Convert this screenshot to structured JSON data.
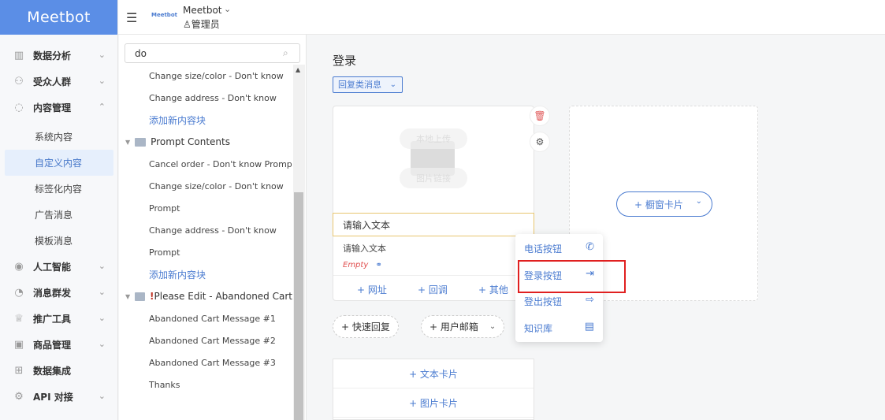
{
  "app": {
    "brand": "Meetbot"
  },
  "nav": {
    "items": [
      {
        "label": "数据分析",
        "icon": "chart-icon",
        "chevron": "⌄"
      },
      {
        "label": "受众人群",
        "icon": "users-icon",
        "chevron": "⌄"
      },
      {
        "label": "内容管理",
        "icon": "chat-icon",
        "chevron": "⌃"
      }
    ],
    "subitems": [
      "系统内容",
      "自定义内容",
      "标签化内容",
      "广告消息",
      "模板消息"
    ],
    "items2": [
      {
        "label": "人工智能",
        "icon": "ai-icon",
        "chevron": "⌄"
      },
      {
        "label": "消息群发",
        "icon": "clock-icon",
        "chevron": "⌄"
      },
      {
        "label": "推广工具",
        "icon": "promo-icon",
        "chevron": "⌄"
      },
      {
        "label": "商品管理",
        "icon": "box-icon",
        "chevron": "⌄"
      },
      {
        "label": "数据集成",
        "icon": "grid-icon",
        "chevron": ""
      },
      {
        "label": "API 对接",
        "icon": "api-icon",
        "chevron": "⌄"
      }
    ]
  },
  "topbar": {
    "logo_text": "Meetbot",
    "bot_name": "Meetbot",
    "role": "管理员"
  },
  "tree": {
    "search_value": "do",
    "rows": [
      {
        "type": "leaf",
        "label": "Change size/color - Don't know"
      },
      {
        "type": "leaf",
        "label": "Change address - Don't know"
      },
      {
        "type": "link",
        "label": "添加新内容块"
      },
      {
        "type": "folder",
        "label": "Prompt Contents"
      },
      {
        "type": "leaf",
        "label": "Cancel order - Don't know Prompt"
      },
      {
        "type": "leaf",
        "label": "Change size/color - Don't know"
      },
      {
        "type": "leaf",
        "label": "Prompt"
      },
      {
        "type": "leaf",
        "label": "Change address - Don't know"
      },
      {
        "type": "leaf",
        "label": "Prompt"
      },
      {
        "type": "link",
        "label": "添加新内容块"
      },
      {
        "type": "folder",
        "label": "Please Edit - Abandoned Cart",
        "flag": "!"
      },
      {
        "type": "leaf",
        "label": "Abandoned Cart Message #1"
      },
      {
        "type": "leaf",
        "label": "Abandoned Cart Message #2"
      },
      {
        "type": "leaf",
        "label": "Abandoned Cart Message #3"
      },
      {
        "type": "leaf",
        "label": "Thanks"
      }
    ]
  },
  "main": {
    "title": "登录",
    "type_dropdown": "回复类消息",
    "card": {
      "upload_text": "本地上传",
      "link_text": "图片链接",
      "title_placeholder": "请输入文本",
      "body_text": "请输入文本",
      "empty_label": "Empty",
      "buttons": [
        "+ 网址",
        "+ 回调",
        "+ 其他"
      ]
    },
    "carousel_button": "+ 橱窗卡片",
    "quick_reply": "+ 快速回复",
    "user_email": "+ 用户邮箱",
    "stack_buttons": [
      "+  文本卡片",
      "+  图片卡片"
    ]
  },
  "menu": {
    "items": [
      {
        "label": "电话按钮",
        "icon": "phone-icon"
      },
      {
        "label": "登录按钮",
        "icon": "login-icon"
      },
      {
        "label": "登出按钮",
        "icon": "logout-icon"
      },
      {
        "label": "知识库",
        "icon": "book-icon"
      }
    ]
  },
  "colors": {
    "brand": "#5b8ee6",
    "accent": "#4a7bd0",
    "highlight": "#e02020",
    "danger": "#e05a5a"
  }
}
